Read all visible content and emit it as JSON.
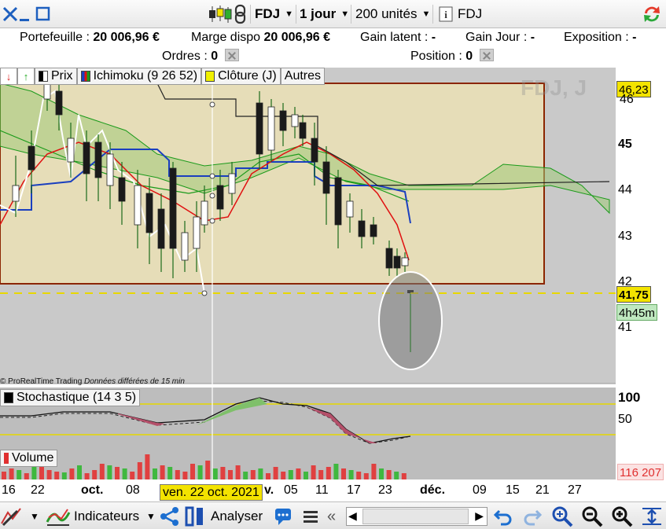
{
  "toolbar": {
    "symbol": "FDJ",
    "timeframe": "1 jour",
    "units": "200 unités",
    "info_symbol": "FDJ"
  },
  "account": {
    "portfolio_label": "Portefeuille :",
    "portfolio_value": "20 006,96 €",
    "margin_label": "Marge dispo",
    "margin_value": "20 006,96 €",
    "latent_label": "Gain latent :",
    "latent_value": "-",
    "day_gain_label": "Gain Jour :",
    "day_gain_value": "-",
    "exposure_label": "Exposition :",
    "exposure_value": "-",
    "orders_label": "Ordres :",
    "orders_value": "0",
    "position_label": "Position :",
    "position_value": "0"
  },
  "legend": {
    "price": "Prix",
    "ichimoku": "Ichimoku (9 26 52)",
    "close": "Clôture (J)",
    "others": "Autres"
  },
  "chart": {
    "watermark": "FDJ, J",
    "source_note": "© ProRealTime Trading",
    "delay_note": "Données différées de 15 min",
    "price_tag_top": "46,23",
    "price_tag_current": "41,75",
    "countdown": "4h45m",
    "y_ticks": [
      "46",
      "45",
      "44",
      "43",
      "42",
      "41"
    ],
    "stoch_title": "Stochastique (14 3 5)",
    "stoch_ticks": [
      "100",
      "50"
    ],
    "volume_title": "Volume",
    "volume_value": "116 207",
    "x_labels": [
      {
        "text": "16",
        "bold": false
      },
      {
        "text": "22",
        "bold": false
      },
      {
        "text": "oct.",
        "bold": true
      },
      {
        "text": "08",
        "bold": false
      },
      {
        "text": "v.",
        "bold": true
      },
      {
        "text": "05",
        "bold": false
      },
      {
        "text": "11",
        "bold": false
      },
      {
        "text": "17",
        "bold": false
      },
      {
        "text": "23",
        "bold": false
      },
      {
        "text": "déc.",
        "bold": true
      },
      {
        "text": "09",
        "bold": false
      },
      {
        "text": "15",
        "bold": false
      },
      {
        "text": "21",
        "bold": false
      },
      {
        "text": "27",
        "bold": false
      }
    ],
    "cursor_date": "ven. 22 oct. 2021",
    "colors": {
      "cloud": "#e8d9a8",
      "tenkan": "#e01010",
      "kijun": "#1a3fbf",
      "close_line": "#ffffff",
      "chikou": "#1a9a1a",
      "box_border": "#8b2500",
      "current_price": "#e8d800"
    }
  },
  "bottom": {
    "indicators": "Indicateurs",
    "analyze": "Analyser"
  }
}
